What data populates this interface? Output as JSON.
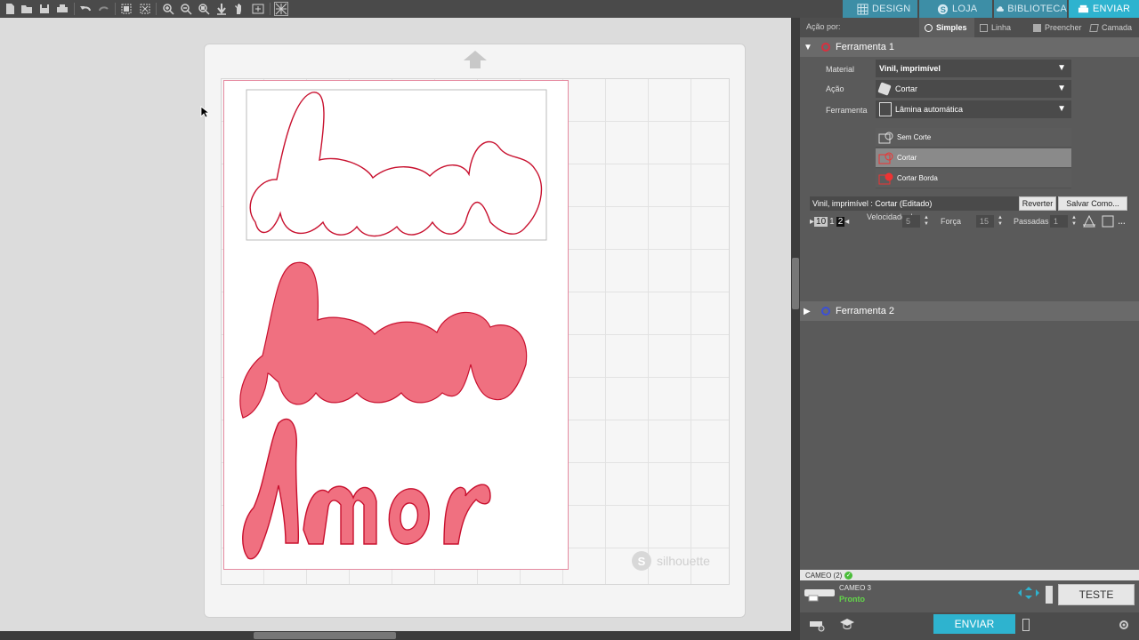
{
  "toolbar": {
    "icons": [
      "new-file-icon",
      "open-folder-icon",
      "save-icon",
      "print-icon",
      "undo-icon",
      "redo-icon",
      "select-all-icon",
      "deselect-icon",
      "zoom-in-icon",
      "zoom-out-icon",
      "zoom-fit-icon",
      "move-down-icon",
      "pan-hand-icon",
      "fit-page-icon",
      "pattern-icon"
    ]
  },
  "nav_tabs": [
    {
      "label": "DESIGN",
      "icon": "grid-icon"
    },
    {
      "label": "LOJA",
      "icon": "silhouette-s-icon"
    },
    {
      "label": "BIBLIOTECA",
      "icon": "cloud-icon"
    },
    {
      "label": "ENVIAR",
      "icon": "printer-icon"
    }
  ],
  "canvas": {
    "art_text": "Amor",
    "watermark": "silhouette",
    "colors": {
      "cut_line": "#c8102e",
      "fill": "#f07080",
      "page_border": "#e58aa0"
    }
  },
  "panel": {
    "action_label": "Ação por:",
    "modes": [
      {
        "label": "Simples",
        "icon": "radio-icon"
      },
      {
        "label": "Linha",
        "icon": "line-icon"
      },
      {
        "label": "Preencher",
        "icon": "fill-icon"
      },
      {
        "label": "Camada",
        "icon": "layer-icon"
      }
    ],
    "tool1": {
      "title": "Ferramenta 1",
      "color": "#d9303f",
      "material_label": "Material",
      "material_value": "Vinil, imprimível",
      "action_label": "Ação",
      "action_value": "Cortar",
      "tool_label": "Ferramenta",
      "tool_value": "Lâmina automática",
      "options": [
        "Sem Corte",
        "Cortar",
        "Cortar Borda"
      ],
      "selected_option": "Cortar",
      "preset": "Vinil, imprimível : Cortar (Editado)",
      "revert": "Reverter",
      "save_as": "Salvar Como...",
      "blade_depth": "10",
      "speed_label": "Velocidade de",
      "speed": "5",
      "force_label": "Força",
      "force": "15",
      "passes_label": "Passadas",
      "passes": "1"
    },
    "tool2": {
      "title": "Ferramenta 2",
      "color": "#3b4fd6"
    },
    "device_status": "CAMEO (2)",
    "device_name": "CAMEO 3",
    "device_state": "Pronto",
    "test_button": "TESTE",
    "send_button": "ENVIAR"
  }
}
